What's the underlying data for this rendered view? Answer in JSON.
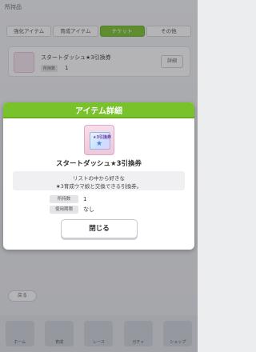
{
  "background": {
    "header_title": "所持品",
    "tabs": [
      {
        "label": "強化アイテム",
        "active": false
      },
      {
        "label": "育成アイテム",
        "active": false
      },
      {
        "label": "チケット",
        "active": true
      },
      {
        "label": "その他",
        "active": false
      }
    ],
    "item": {
      "name": "スタートダッシュ★3引換券",
      "badge": "所持数",
      "count": "1",
      "button_label": "詳細"
    },
    "back_label": "戻る",
    "nav_items": [
      "ホーム",
      "育成",
      "レース",
      "ガチャ",
      "ショップ"
    ]
  },
  "modal": {
    "title": "アイテム詳細",
    "ticket_label": "★3引換券",
    "item_name": "スタートダッシュ★3引換券",
    "description_line1": "リストの中から好きな",
    "description_line2": "★3育成ウマ娘と交換できる引換券。",
    "rows": [
      {
        "label": "所持数",
        "value": "1"
      },
      {
        "label": "使用期限",
        "value": "なし"
      }
    ],
    "close_label": "閉じる"
  },
  "colors": {
    "header_green": "#79c22b",
    "overlay": "rgba(40,40,50,0.35)",
    "icon_bg_pink": "#f8ddea"
  }
}
